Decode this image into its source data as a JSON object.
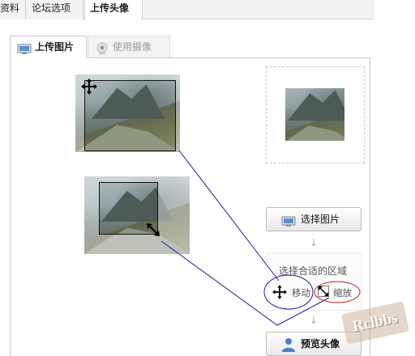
{
  "top_tabs": [
    {
      "label": "资料",
      "active": false
    },
    {
      "label": "论坛选项",
      "active": false
    },
    {
      "label": "上传头像",
      "active": true
    }
  ],
  "upload_tabs": [
    {
      "label": "上传图片",
      "active": true,
      "icon": "monitor-icon"
    },
    {
      "label": "使用摄像头",
      "active": false,
      "icon": "webcam-icon"
    }
  ],
  "steps": {
    "choose_image_label": "选择图片",
    "choose_area_label": "选择合适的区域",
    "move_label": "移动",
    "zoom_label": "缩放",
    "preview_label": "预览头像",
    "step_arrow": "↓"
  },
  "watermark": "Rclbbs",
  "colors": {
    "annotation_line": "#1a1aa8",
    "zoom_circle": "#cc2222",
    "move_circle": "#1a1aa8"
  }
}
